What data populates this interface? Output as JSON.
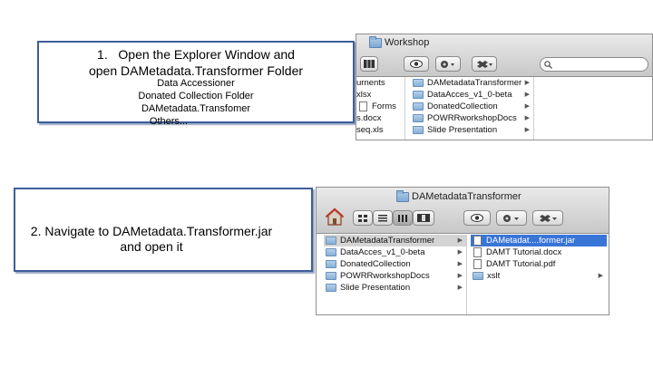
{
  "callout1": {
    "step_num": "1.",
    "line1": "Open the Explorer Window and",
    "line2": "open DAMetadata.Transformer Folder",
    "paths": [
      "Data Accessioner",
      "Donated Collection Folder",
      "DAMetadata.Transfomer",
      "Others..."
    ]
  },
  "callout2": {
    "line1": "2. Navigate to DAMetadata.Transformer.jar",
    "line2": "and open it"
  },
  "finder1": {
    "title": "Workshop",
    "col1": [
      "urnents",
      "xlsx",
      "Forms",
      "s.docx",
      "seq.xls"
    ],
    "col2": [
      "DAMetadataTransformer",
      "DataAcces_v1_0-beta",
      "DonatedCollection",
      "POWRRworkshopDocs",
      "Slide Presentation"
    ]
  },
  "finder2": {
    "title": "DAMetadataTransformer",
    "col1": [
      "DAMetadataTransformer",
      "DataAcces_v1_0-beta",
      "DonatedCollection",
      "POWRRworkshopDocs",
      "Slide Presentation"
    ],
    "col2": [
      "DAMetadat....former.jar",
      "DAMT Tutorial.docx",
      "DAMT Tutorial.pdf",
      "xslt"
    ]
  },
  "colors": {
    "selection": "#3875d7",
    "callout_border": "#3e5e9a"
  }
}
